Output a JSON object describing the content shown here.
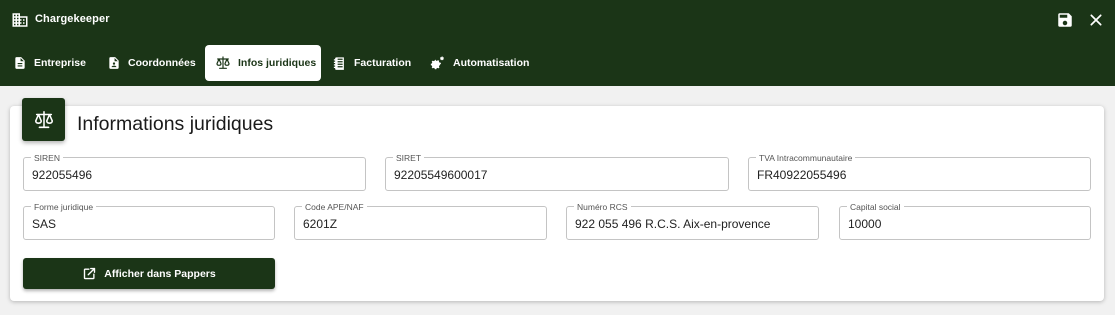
{
  "app": {
    "title": "Chargekeeper",
    "icon": "building-icon"
  },
  "window_controls": {
    "save": "save-icon",
    "close": "close-icon"
  },
  "tabs": [
    {
      "label": "Entreprise",
      "icon": "document-icon",
      "active": false
    },
    {
      "label": "Coordonnées",
      "icon": "contact-card-icon",
      "active": false
    },
    {
      "label": "Infos juridiques",
      "icon": "scale-icon",
      "active": true
    },
    {
      "label": "Facturation",
      "icon": "invoice-icon",
      "active": false
    },
    {
      "label": "Automatisation",
      "icon": "gears-icon",
      "active": false
    }
  ],
  "section": {
    "title": "Informations juridiques",
    "icon": "scale-icon"
  },
  "fields": {
    "siren": {
      "label": "SIREN",
      "value": "922055496"
    },
    "siret": {
      "label": "SIRET",
      "value": "92205549600017"
    },
    "tva": {
      "label": "TVA Intracommunautaire",
      "value": "FR40922055496"
    },
    "forme": {
      "label": "Forme juridique",
      "value": "SAS"
    },
    "ape": {
      "label": "Code APE/NAF",
      "value": "6201Z"
    },
    "rcs": {
      "label": "Numéro RCS",
      "value": "922 055 496 R.C.S. Aix-en-provence"
    },
    "capital": {
      "label": "Capital social",
      "value": "10000"
    }
  },
  "actions": {
    "pappers_label": "Afficher dans Pappers",
    "pappers_icon": "open-external-icon"
  },
  "colors": {
    "primary": "#1b3517",
    "background": "#f1f1f1",
    "border": "#c4c4c4"
  }
}
